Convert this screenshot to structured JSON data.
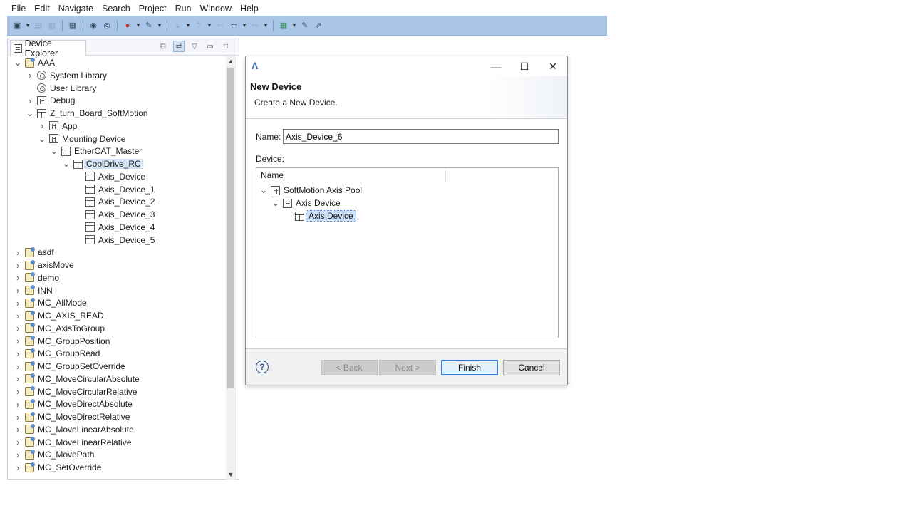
{
  "menu": [
    "File",
    "Edit",
    "Navigate",
    "Search",
    "Project",
    "Run",
    "Window",
    "Help"
  ],
  "explorer": {
    "tab_label": "Device Explorer",
    "tree": [
      {
        "label": "AAA",
        "depth": 0,
        "toggle": "open",
        "icon": "project-icon"
      },
      {
        "label": "System Library",
        "depth": 1,
        "toggle": "closed",
        "icon": "library-icon"
      },
      {
        "label": "User Library",
        "depth": 1,
        "toggle": "none",
        "icon": "library-icon"
      },
      {
        "label": "Debug",
        "depth": 1,
        "toggle": "closed",
        "icon": "grid-icon"
      },
      {
        "label": "Z_turn_Board_SoftMotion",
        "depth": 1,
        "toggle": "open",
        "icon": "device-icon"
      },
      {
        "label": "App",
        "depth": 2,
        "toggle": "closed",
        "icon": "grid-icon"
      },
      {
        "label": "Mounting Device",
        "depth": 2,
        "toggle": "open",
        "icon": "grid-icon"
      },
      {
        "label": "EtherCAT_Master",
        "depth": 3,
        "toggle": "open",
        "icon": "device-icon"
      },
      {
        "label": "CoolDrive_RC",
        "depth": 4,
        "toggle": "open",
        "icon": "device-icon",
        "selected": true
      },
      {
        "label": "Axis_Device",
        "depth": 5,
        "toggle": "none",
        "icon": "device-icon"
      },
      {
        "label": "Axis_Device_1",
        "depth": 5,
        "toggle": "none",
        "icon": "device-icon"
      },
      {
        "label": "Axis_Device_2",
        "depth": 5,
        "toggle": "none",
        "icon": "device-icon"
      },
      {
        "label": "Axis_Device_3",
        "depth": 5,
        "toggle": "none",
        "icon": "device-icon"
      },
      {
        "label": "Axis_Device_4",
        "depth": 5,
        "toggle": "none",
        "icon": "device-icon"
      },
      {
        "label": "Axis_Device_5",
        "depth": 5,
        "toggle": "none",
        "icon": "device-icon"
      },
      {
        "label": "asdf",
        "depth": 0,
        "toggle": "closed",
        "icon": "project-icon"
      },
      {
        "label": "axisMove",
        "depth": 0,
        "toggle": "closed",
        "icon": "project-icon"
      },
      {
        "label": "demo",
        "depth": 0,
        "toggle": "closed",
        "icon": "project-icon"
      },
      {
        "label": "INN",
        "depth": 0,
        "toggle": "closed",
        "icon": "project-icon"
      },
      {
        "label": "MC_AllMode",
        "depth": 0,
        "toggle": "closed",
        "icon": "project-icon"
      },
      {
        "label": "MC_AXIS_READ",
        "depth": 0,
        "toggle": "closed",
        "icon": "project-icon"
      },
      {
        "label": "MC_AxisToGroup",
        "depth": 0,
        "toggle": "closed",
        "icon": "project-icon"
      },
      {
        "label": "MC_GroupPosition",
        "depth": 0,
        "toggle": "closed",
        "icon": "project-icon"
      },
      {
        "label": "MC_GroupRead",
        "depth": 0,
        "toggle": "closed",
        "icon": "project-icon"
      },
      {
        "label": "MC_GroupSetOverride",
        "depth": 0,
        "toggle": "closed",
        "icon": "project-icon"
      },
      {
        "label": "MC_MoveCircularAbsolute",
        "depth": 0,
        "toggle": "closed",
        "icon": "project-icon"
      },
      {
        "label": "MC_MoveCircularRelative",
        "depth": 0,
        "toggle": "closed",
        "icon": "project-icon"
      },
      {
        "label": "MC_MoveDirectAbsolute",
        "depth": 0,
        "toggle": "closed",
        "icon": "project-icon"
      },
      {
        "label": "MC_MoveDirectRelative",
        "depth": 0,
        "toggle": "closed",
        "icon": "project-icon"
      },
      {
        "label": "MC_MoveLinearAbsolute",
        "depth": 0,
        "toggle": "closed",
        "icon": "project-icon"
      },
      {
        "label": "MC_MoveLinearRelative",
        "depth": 0,
        "toggle": "closed",
        "icon": "project-icon"
      },
      {
        "label": "MC_MovePath",
        "depth": 0,
        "toggle": "closed",
        "icon": "project-icon"
      },
      {
        "label": "MC_SetOverride",
        "depth": 0,
        "toggle": "closed",
        "icon": "project-icon"
      }
    ]
  },
  "dialog": {
    "title": "New Device",
    "description": "Create a New Device.",
    "name_label": "Name:",
    "name_value": "Axis_Device_6",
    "device_label": "Device:",
    "column_name": "Name",
    "device_tree": [
      {
        "label": "SoftMotion Axis Pool",
        "depth": 0,
        "toggle": "open",
        "icon": "grid-icon"
      },
      {
        "label": "Axis Device",
        "depth": 1,
        "toggle": "open",
        "icon": "grid-icon"
      },
      {
        "label": "Axis Device",
        "depth": 2,
        "toggle": "none",
        "icon": "device-icon",
        "selected": true
      }
    ],
    "buttons": {
      "back": "< Back",
      "next": "Next >",
      "finish": "Finish",
      "cancel": "Cancel"
    }
  }
}
